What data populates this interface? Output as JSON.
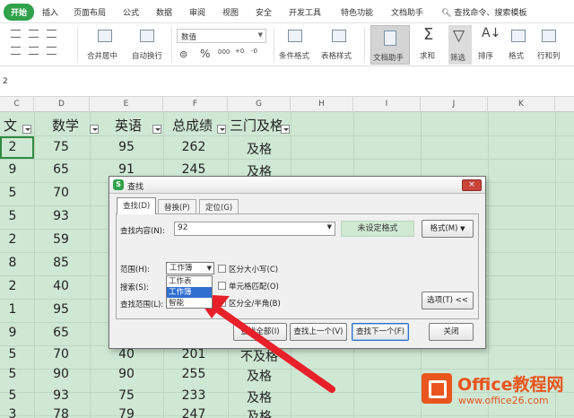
{
  "ribbon_tabs": [
    "开始",
    "插入",
    "页面布局",
    "公式",
    "数据",
    "审阅",
    "视图",
    "安全",
    "开发工具",
    "特色功能",
    "文档助手"
  ],
  "search_placeholder": "查找命令、搜索模板",
  "ribbon": {
    "merge_label": "合并居中",
    "wrap_label": "自动换行",
    "number_format_value": "数值",
    "percent_symbol": "%",
    "cond_format_label": "条件格式",
    "table_style_label": "表格样式",
    "doc_helper_label": "文档助手",
    "sum_label": "求和",
    "filter_label": "筛选",
    "sort_label": "排序",
    "format_label": "格式",
    "rowcol_label": "行和列"
  },
  "name_box": "2",
  "column_letters": [
    "C",
    "D",
    "E",
    "F",
    "G",
    "H",
    "I",
    "J",
    "K"
  ],
  "headers": [
    "文",
    "数学",
    "英语",
    "总成绩",
    "三门及格"
  ],
  "rows": [
    [
      "2",
      "75",
      "95",
      "262",
      "及格"
    ],
    [
      "9",
      "65",
      "91",
      "245",
      "及格"
    ],
    [
      "5",
      "70",
      "",
      "",
      ""
    ],
    [
      "5",
      "93",
      "",
      "",
      ""
    ],
    [
      "2",
      "59",
      "",
      "",
      ""
    ],
    [
      "8",
      "85",
      "",
      "",
      ""
    ],
    [
      "2",
      "40",
      "",
      "",
      ""
    ],
    [
      "1",
      "95",
      "",
      "",
      ""
    ],
    [
      "9",
      "65",
      "",
      "",
      ""
    ],
    [
      "5",
      "70",
      "40",
      "201",
      "不及格"
    ],
    [
      "5",
      "90",
      "90",
      "255",
      "及格"
    ],
    [
      "5",
      "93",
      "75",
      "233",
      "及格"
    ],
    [
      "3",
      "78",
      "79",
      "247",
      "及格"
    ]
  ],
  "dialog": {
    "title": "查找",
    "close": "×",
    "tabs": [
      "查找(D)",
      "替换(P)",
      "定位(G)"
    ],
    "find_label": "查找内容(N):",
    "find_value": "92",
    "no_format": "未设定格式",
    "format_button": "格式(M)",
    "scope_label": "范围(H):",
    "scope_value": "工作簿",
    "search_label": "搜索(S):",
    "look_in_label": "查找范围(L):",
    "scope_options": [
      "工作表",
      "工作簿",
      "智能"
    ],
    "match_case": "区分大小写(C)",
    "match_cell": "单元格匹配(O)",
    "match_width": "区分全/半角(B)",
    "options_button": "选项(T) <<",
    "find_all_button": "查找全部(I)",
    "find_prev_button": "查找上一个(V)",
    "find_next_button": "查找下一个(F)",
    "close_button": "关闭"
  },
  "watermark": {
    "name": "Office教程网",
    "url": "www.office26.com"
  },
  "colors": {
    "accent": "#2fa24a",
    "sheet_bg": "#cfe8d4",
    "arrow": "#e8202a"
  }
}
